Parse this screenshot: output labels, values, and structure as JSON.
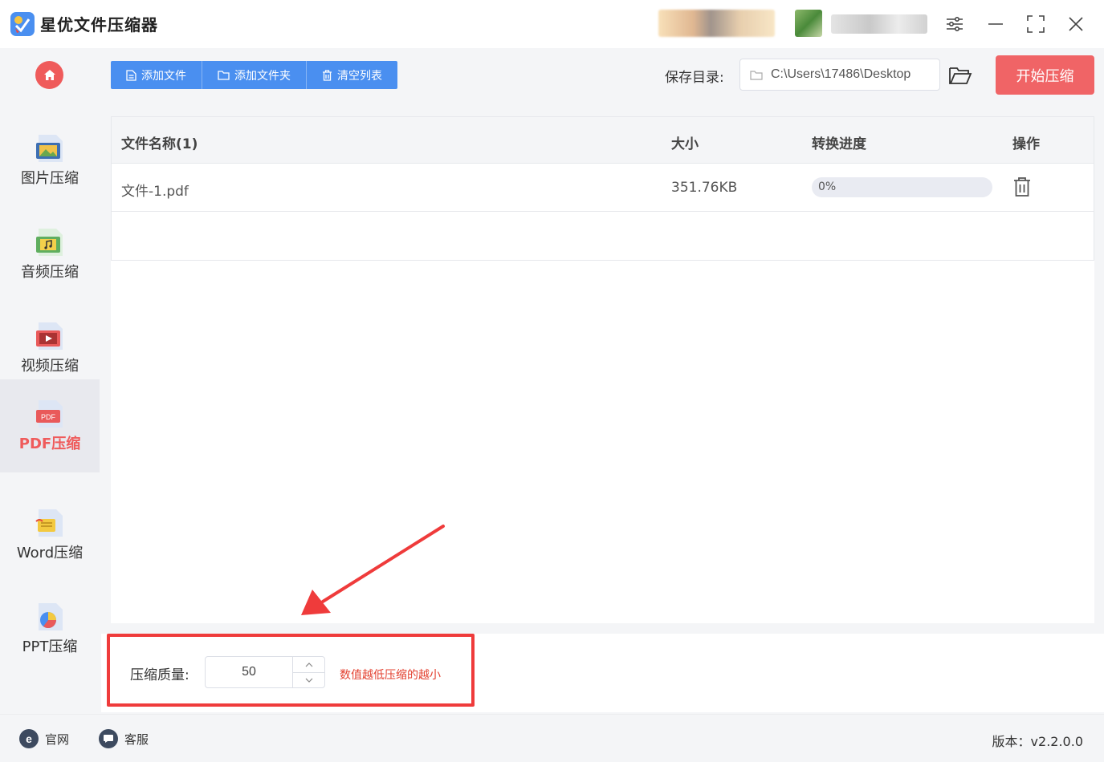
{
  "app": {
    "title": "星优文件压缩器"
  },
  "window": {
    "icons": [
      "settings-sliders-icon",
      "minimize-icon",
      "maximize-icon",
      "close-icon"
    ]
  },
  "sidebar": {
    "items": [
      {
        "label": "图片压缩",
        "icon": "image-file-icon",
        "active": false
      },
      {
        "label": "音频压缩",
        "icon": "audio-file-icon",
        "active": false
      },
      {
        "label": "视频压缩",
        "icon": "video-file-icon",
        "active": false
      },
      {
        "label": "PDF压缩",
        "icon": "pdf-file-icon",
        "active": true
      },
      {
        "label": "Word压缩",
        "icon": "word-file-icon",
        "active": false
      },
      {
        "label": "PPT压缩",
        "icon": "ppt-file-icon",
        "active": false
      }
    ]
  },
  "toolbar": {
    "add_file": "添加文件",
    "add_folder": "添加文件夹",
    "clear_list": "清空列表",
    "save_dir_label": "保存目录:",
    "save_dir_value": "C:\\Users\\17486\\Desktop",
    "start_button": "开始压缩"
  },
  "table": {
    "headers": {
      "name": "文件名称(1)",
      "size": "大小",
      "progress": "转换进度",
      "action": "操作"
    },
    "rows": [
      {
        "name": "文件-1.pdf",
        "size": "351.76KB",
        "progress_text": "0%",
        "progress_value": 0
      }
    ]
  },
  "settings": {
    "quality_label": "压缩质量:",
    "quality_value": "50",
    "quality_hint": "数值越低压缩的越小"
  },
  "footer": {
    "website": "官网",
    "support": "客服",
    "version": "版本：v2.2.0.0"
  },
  "colors": {
    "accent_blue": "#4a8ff0",
    "accent_red": "#f06466",
    "highlight_red": "#ef3b3b"
  }
}
